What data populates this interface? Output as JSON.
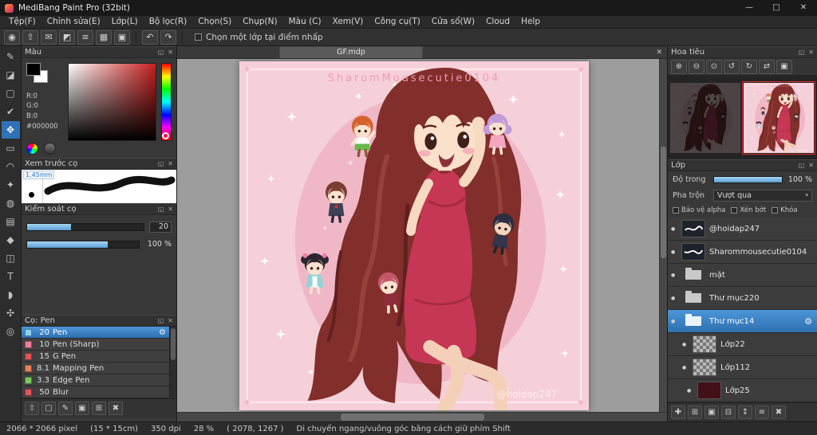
{
  "window": {
    "title": "MediBang Paint Pro (32bit)",
    "minimize": "—",
    "maximize": "□",
    "close": "✕"
  },
  "menu": {
    "items": [
      "Tệp(F)",
      "Chỉnh sửa(E)",
      "Lớp(L)",
      "Bộ lọc(R)",
      "Chọn(S)",
      "Chụp(N)",
      "Màu (C)",
      "Xem(V)",
      "Công cụ(T)",
      "Cửa sổ(W)",
      "Cloud",
      "Help"
    ]
  },
  "toolbar": {
    "icons": [
      {
        "name": "paint-mode",
        "glyph": "◉"
      },
      {
        "name": "publish",
        "glyph": "⇧"
      },
      {
        "name": "comment",
        "glyph": "✉"
      },
      {
        "name": "material",
        "glyph": "◩"
      },
      {
        "name": "memo",
        "glyph": "≡"
      },
      {
        "name": "grid",
        "glyph": "▦"
      },
      {
        "name": "window-layout",
        "glyph": "▣"
      }
    ],
    "undo": "↶",
    "redo": "↷",
    "checkbox_label": "Chọn một lớp tại điểm nhấp"
  },
  "tools": {
    "items": [
      {
        "name": "pen",
        "glyph": "✎"
      },
      {
        "name": "eraser",
        "glyph": "◪"
      },
      {
        "name": "finger",
        "glyph": "▢"
      },
      {
        "name": "select-pen",
        "glyph": "✔"
      },
      {
        "name": "move",
        "glyph": "✥"
      },
      {
        "name": "marquee",
        "glyph": "▭"
      },
      {
        "name": "lasso",
        "glyph": "◠"
      },
      {
        "name": "magic-wand",
        "glyph": "✦"
      },
      {
        "name": "bucket",
        "glyph": "◍"
      },
      {
        "name": "gradient",
        "glyph": "▤"
      },
      {
        "name": "shape",
        "glyph": "◆"
      },
      {
        "name": "divide",
        "glyph": "◫"
      },
      {
        "name": "text",
        "glyph": "T"
      },
      {
        "name": "eyedropper",
        "glyph": "◗"
      },
      {
        "name": "hand",
        "glyph": "✣"
      },
      {
        "name": "zoom",
        "glyph": "◎"
      }
    ]
  },
  "panel_chrome": {
    "popout": "◱",
    "close": "✕"
  },
  "color_panel": {
    "title": "Màu",
    "r": "R:0",
    "g": "G:0",
    "b": "B:0",
    "hex": "#000000"
  },
  "brush_preview": {
    "title": "Xem trước cọ",
    "size": "1.45mm"
  },
  "brush_control": {
    "title": "Kiểm soát cọ",
    "size_value": "20",
    "opacity_value": "100 %"
  },
  "brush_panel": {
    "title": "Cọ: Pen",
    "gear": "⚙",
    "items": [
      {
        "size": "20",
        "name": "Pen",
        "color": "#8fd0f2"
      },
      {
        "size": "10",
        "name": "Pen (Sharp)",
        "color": "#ef7d9a"
      },
      {
        "size": "15",
        "name": "G Pen",
        "color": "#e05555"
      },
      {
        "size": "8.1",
        "name": "Mapping Pen",
        "color": "#e8825a"
      },
      {
        "size": "3.3",
        "name": "Edge Pen",
        "color": "#7cc95b"
      },
      {
        "size": "50",
        "name": "Blur",
        "color": "#e05555"
      }
    ]
  },
  "left_footer": {
    "icons": [
      {
        "name": "expand",
        "glyph": "⇧"
      },
      {
        "name": "new-brush",
        "glyph": "▢"
      },
      {
        "name": "edit-brush",
        "glyph": "✎"
      },
      {
        "name": "brush-folder",
        "glyph": "▣"
      },
      {
        "name": "duplicate-brush",
        "glyph": "⊞"
      },
      {
        "name": "delete-brush",
        "glyph": "✖"
      }
    ]
  },
  "canvas": {
    "tab": "GF.mdp",
    "close": "✕",
    "watermark_top": "SharomMousecutie0104",
    "watermark_bottom": "@hoidap247"
  },
  "navigator": {
    "title": "Hoa tiêu",
    "icons": [
      {
        "name": "zoom-in",
        "glyph": "⊕"
      },
      {
        "name": "zoom-out",
        "glyph": "⊖"
      },
      {
        "name": "zoom-reset",
        "glyph": "⊙"
      },
      {
        "name": "rotate-left",
        "glyph": "↺"
      },
      {
        "name": "rotate-right",
        "glyph": "↻"
      },
      {
        "name": "flip",
        "glyph": "⇄"
      },
      {
        "name": "fit-window",
        "glyph": "▣"
      }
    ]
  },
  "layers": {
    "title": "Lớp",
    "opacity_label": "Độ trong",
    "opacity_value": "100 %",
    "blend_label": "Pha trộn",
    "blend_value": "Vượt qua",
    "caret": "▾",
    "protect_alpha": "Bảo vệ alpha",
    "clipping": "Xén bớt",
    "lock": "Khóa",
    "gear": "⚙",
    "bullet": "●",
    "items": [
      {
        "name": "@hoidap247"
      },
      {
        "name": "Sharommousecutie0104"
      },
      {
        "name": "mặt"
      },
      {
        "name": "Thư mục220"
      },
      {
        "name": "Thư mục14"
      },
      {
        "name": "Lớp22"
      },
      {
        "name": "Lớp112"
      },
      {
        "name": "Lớp25"
      }
    ],
    "footer": {
      "icons": [
        {
          "name": "add-layer",
          "glyph": "✚"
        },
        {
          "name": "add-folder",
          "glyph": "⊞"
        },
        {
          "name": "duplicate-layer",
          "glyph": "▣"
        },
        {
          "name": "merge-layer",
          "glyph": "⊟"
        },
        {
          "name": "move-layer",
          "glyph": "↕"
        },
        {
          "name": "layer-settings",
          "glyph": "≡"
        },
        {
          "name": "delete-layer",
          "glyph": "✖"
        }
      ]
    }
  },
  "statusbar": {
    "size": "2066 * 2066 pixel",
    "dims": "(15 * 15cm)",
    "dpi": "350 dpi",
    "zoom": "28 %",
    "coords": "( 2078, 1267 )",
    "hint": "Di chuyển ngang/vuông góc bằng cách giữ phím Shift"
  }
}
